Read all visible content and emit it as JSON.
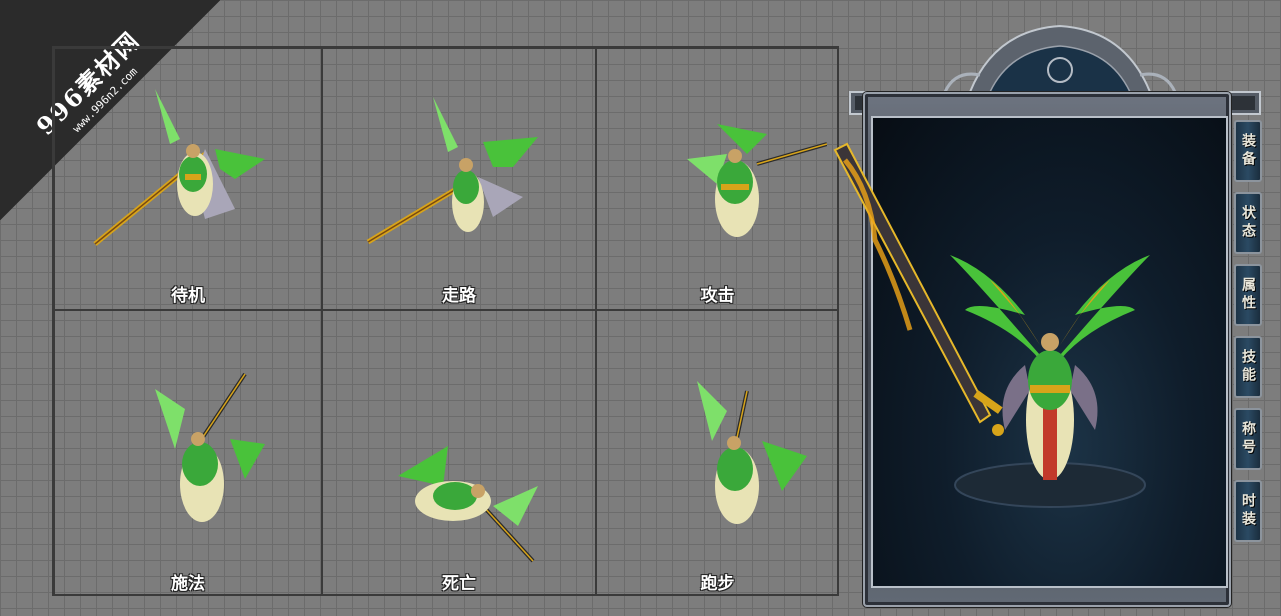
{
  "watermark": {
    "main": "996素材网",
    "sub": "www.996n2.com"
  },
  "animations": [
    {
      "label": "待机"
    },
    {
      "label": "走路"
    },
    {
      "label": "攻击"
    },
    {
      "label": "施法"
    },
    {
      "label": "死亡"
    },
    {
      "label": "跑步"
    }
  ],
  "tabs": [
    {
      "label": "装备"
    },
    {
      "label": "状态"
    },
    {
      "label": "属性"
    },
    {
      "label": "技能"
    },
    {
      "label": "称号"
    },
    {
      "label": "时装"
    }
  ],
  "colors": {
    "background": "#7d7d7d",
    "grid_line": "#6c6c6c",
    "cell_border": "#3a3a3a",
    "wing_green": "#49c23a",
    "gold": "#d7a41a",
    "panel_dark": "#0f1d2b"
  }
}
